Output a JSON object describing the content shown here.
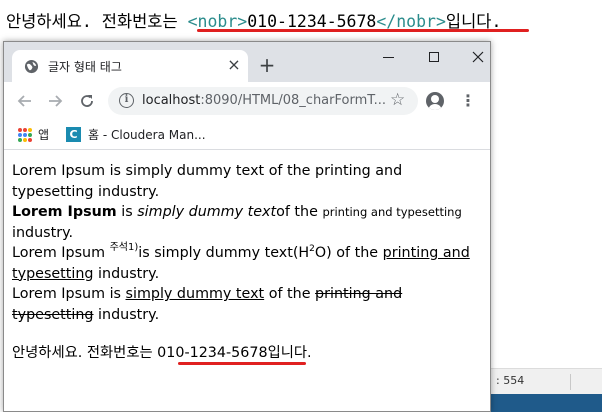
{
  "editor": {
    "code_prefix": "안녕하세요. 전화번호는 ",
    "open_tag": "<nobr>",
    "phone": "010-1234-5678",
    "close_tag": "</nobr>",
    "code_suffix": "입니다.",
    "status_text": ": 554"
  },
  "browser": {
    "tab_title": "글자 형태 태그",
    "tab_close": "×",
    "new_tab": "+",
    "url_host": "localhost",
    "url_rest": ":8090/HTML/08_charFormT...",
    "bookmarks": [
      {
        "label": "앱"
      },
      {
        "label": "홈 - Cloudera Man..."
      }
    ]
  },
  "content": {
    "p1": "Lorem Ipsum is simply dummy text of the printing and typesetting industry.",
    "p2": {
      "bold": "Lorem Ipsum",
      "is": " is ",
      "italic": "simply dummy text",
      "of_the": "of the ",
      "small": "printing and typesetting",
      "end": " industry."
    },
    "p3": {
      "start": "Lorem Ipsum ",
      "sup": "주석1)",
      "mid": "is simply dummy text(H",
      "sub_num": "2",
      "o": "O) of the ",
      "underline": "printing and typesetting",
      "end": " industry."
    },
    "p4": {
      "start": "Lorem Ipsum is ",
      "underline": "simply dummy text",
      "mid": " of the ",
      "strike": "printing and typesetting",
      "end": " industry."
    },
    "p5": {
      "start": "안녕하세요. 전화번호는 ",
      "phone": "010-1234-5678",
      "end": "입니다."
    }
  },
  "colors": {
    "tag": "#2b8c8c",
    "highlight_underline": "#e02020",
    "tabstrip": "#dee1e6",
    "omnibox": "#f1f3f4",
    "cloudera": "#1a8bb0"
  }
}
